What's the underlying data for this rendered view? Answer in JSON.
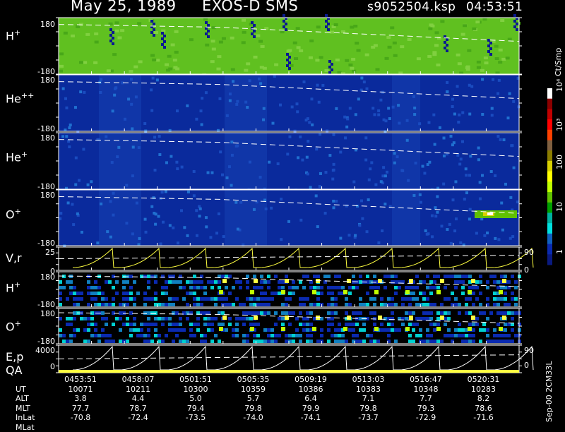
{
  "header": {
    "date": "May 25, 1989",
    "instrument": "EXOS-D SMS",
    "file": "s9052504.ksp",
    "time": "04:53:51"
  },
  "panels": [
    {
      "label": "H",
      "sup": "+",
      "ytop": "180",
      "ybot": "-180"
    },
    {
      "label": "He",
      "sup": "++",
      "ytop": "180",
      "ybot": "-180"
    },
    {
      "label": "He",
      "sup": "+",
      "ytop": "180",
      "ybot": "-180"
    },
    {
      "label": "O",
      "sup": "+",
      "ytop": "180",
      "ybot": "-180"
    },
    {
      "label": "V,r",
      "sup": "",
      "ytop": "25",
      "ybot": "0",
      "right_top": "90",
      "right_bot": "0"
    },
    {
      "label": "H",
      "sup": "+",
      "ytop": "180",
      "ybot": "-180"
    },
    {
      "label": "O",
      "sup": "+",
      "ytop": "180",
      "ybot": "-180"
    },
    {
      "label": "E,p",
      "label2": "QA",
      "sup": "",
      "ytop": "4000",
      "ybot": "0",
      "right_top": "90",
      "right_bot": "0"
    }
  ],
  "colorbar": {
    "unit": "Ct/Smp",
    "ticks": [
      "10⁴",
      "10³",
      "100",
      "10",
      "1"
    ],
    "colors": [
      "#ffffff",
      "#8b0000",
      "#c00000",
      "#ff0000",
      "#ff4000",
      "#806040",
      "#8b7d00",
      "#d8d000",
      "#ffff00",
      "#c0ff00",
      "#60c000",
      "#00a000",
      "#00b0a0",
      "#00e0e0",
      "#1060c0",
      "#0a2ab0",
      "#0a1a80"
    ]
  },
  "chart_data": {
    "type": "heatmap",
    "title": "May 25, 1989   EXOS-D SMS",
    "x_label": "UT",
    "rows": [
      "UT",
      "ALT",
      "MLT",
      "InLat",
      "MLat"
    ],
    "columns": [
      [
        "0453:51",
        "10071",
        "3.8",
        "77.7",
        "-70.8"
      ],
      [
        "0458:07",
        "10211",
        "4.4",
        "78.7",
        "-72.4"
      ],
      [
        "0501:51",
        "10300",
        "5.0",
        "79.4",
        "-73.5"
      ],
      [
        "0505:35",
        "10359",
        "5.7",
        "79.8",
        "-74.0"
      ],
      [
        "0509:19",
        "10386",
        "6.4",
        "79.9",
        "-74.1"
      ],
      [
        "0513:03",
        "10383",
        "7.1",
        "79.8",
        "-73.7"
      ],
      [
        "0516:47",
        "10348",
        "7.7",
        "79.3",
        "-72.9"
      ],
      [
        "0520:31",
        "10283",
        "8.2",
        "78.6",
        "-71.6"
      ]
    ],
    "footer_note": "Sep-00 2CM33L"
  },
  "colors": {
    "h_bg": "#60c020",
    "ion_bg": "#0a2a9c",
    "line": "#ffffff",
    "yellow": "#ffff40"
  }
}
